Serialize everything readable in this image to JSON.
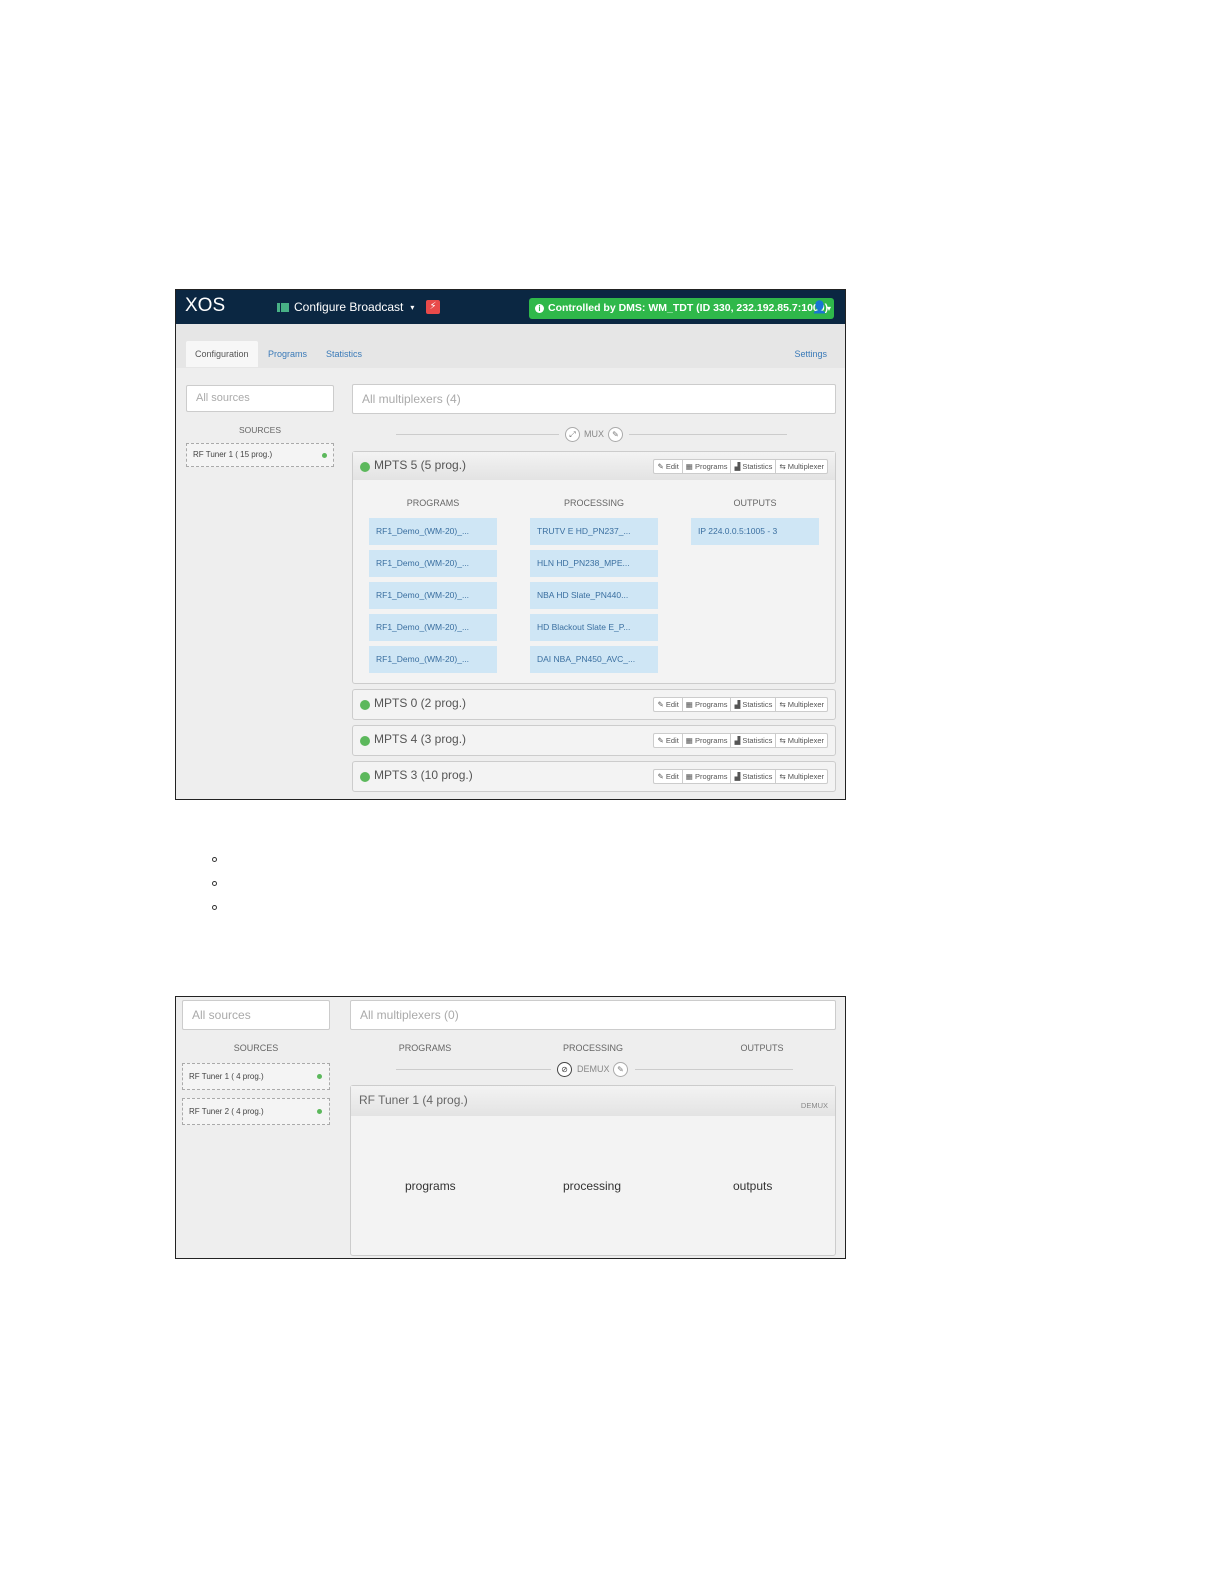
{
  "screenshot_config": {
    "app": {
      "logo": "XOS",
      "menu": "Configure Broadcast",
      "dms_status": "Controlled by DMS: WM_TDT (ID 330, 232.192.85.7:1000)"
    },
    "tabs": [
      "Configuration",
      "Programs",
      "Statistics"
    ],
    "settings_label": "Settings",
    "sources_filter_placeholder": "All sources",
    "mux_filter_placeholder": "All multiplexers (4)",
    "sources_header": "SOURCES",
    "sources": [
      {
        "label": "RF Tuner 1 ( 15 prog.)"
      }
    ],
    "mux_label": "MUX",
    "mux_buttons": [
      "Edit",
      "Programs",
      "Statistics",
      "Multiplexer"
    ],
    "mpts_expanded": {
      "title": "MPTS 5 (5 prog.)",
      "col_programs": "PROGRAMS",
      "col_processing": "PROCESSING",
      "col_outputs": "OUTPUTS",
      "programs": [
        "RF1_Demo_(WM-20)_...",
        "RF1_Demo_(WM-20)_...",
        "RF1_Demo_(WM-20)_...",
        "RF1_Demo_(WM-20)_...",
        "RF1_Demo_(WM-20)_..."
      ],
      "processing": [
        "TRUTV E HD_PN237_...",
        "HLN HD_PN238_MPE...",
        "NBA HD Slate_PN440...",
        "HD Blackout Slate E_P...",
        "DAI NBA_PN450_AVC_..."
      ],
      "outputs": [
        "IP 224.0.0.5:1005  - 3"
      ]
    },
    "mpts_collapsed": [
      "MPTS 0 (2 prog.)",
      "MPTS 4 (3 prog.)",
      "MPTS 3 (10 prog.)"
    ]
  },
  "screenshot_demux": {
    "sources_filter_placeholder": "All sources",
    "mux_filter_placeholder": "All multiplexers (0)",
    "sources_header": "SOURCES",
    "col_programs": "PROGRAMS",
    "col_processing": "PROCESSING",
    "col_outputs": "OUTPUTS",
    "demux_label": "DEMUX",
    "sources": [
      {
        "label": "RF Tuner 1 ( 4 prog.)"
      },
      {
        "label": "RF Tuner 2 ( 4 prog.)"
      }
    ],
    "panel": {
      "title": "RF Tuner 1 (4 prog.)",
      "badge": "DEMUX",
      "programs": "programs",
      "processing": "processing",
      "outputs": "outputs"
    }
  }
}
